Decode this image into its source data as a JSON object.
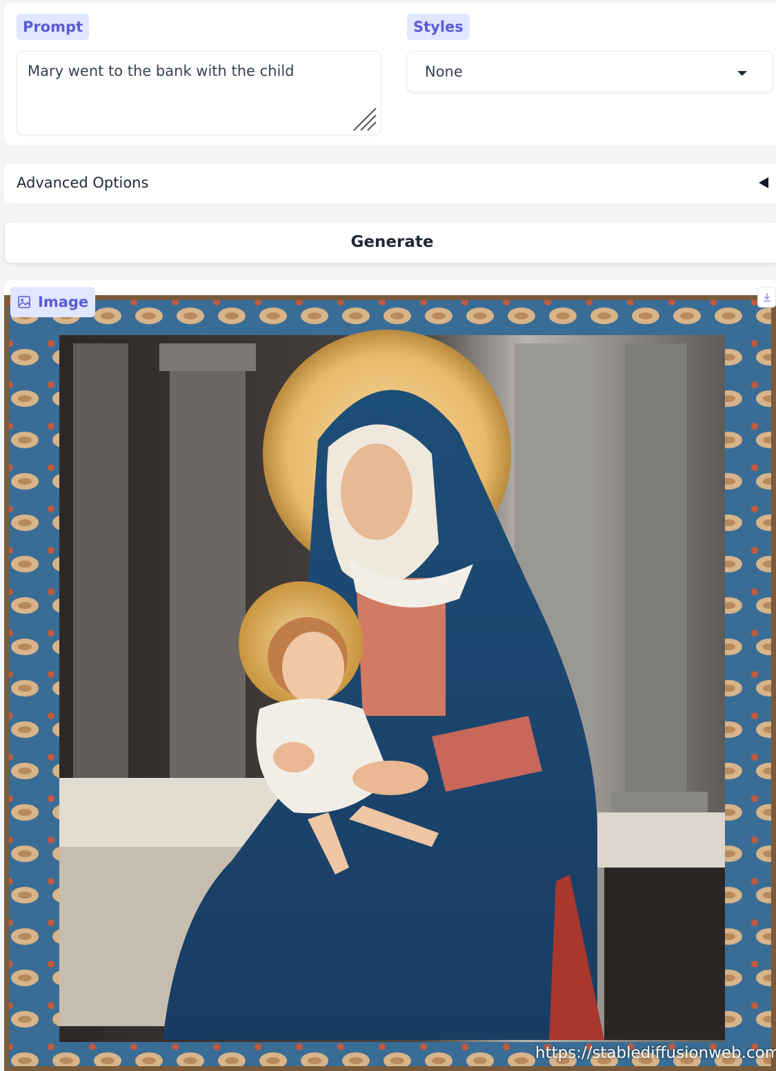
{
  "prompt": {
    "label": "Prompt",
    "value": "Mary went to the bank with the child"
  },
  "styles": {
    "label": "Styles",
    "selected": "None"
  },
  "advanced": {
    "label": "Advanced Options"
  },
  "generate": {
    "label": "Generate"
  },
  "output": {
    "label": "Image",
    "watermark": "https://stablediffusionweb.com"
  },
  "colors": {
    "accent": "#5b5bd6",
    "chip_bg": "#e0e7ff",
    "panel_bg": "#ffffff",
    "page_bg": "#f3f4f6"
  }
}
